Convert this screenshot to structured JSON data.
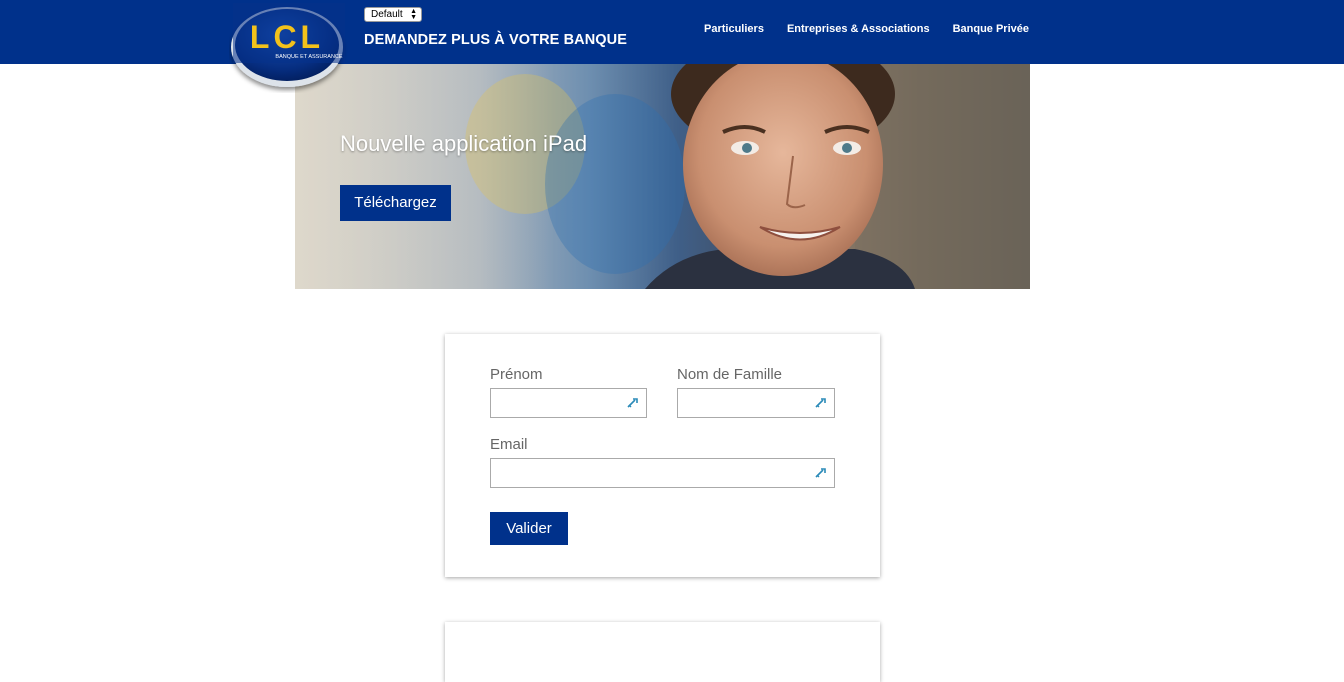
{
  "header": {
    "brand": {
      "logo_text": "LCL",
      "logo_subtext": "BANQUE ET ASSURANCE"
    },
    "variant_select": {
      "value": "Default"
    },
    "tagline": "DEMANDEZ PLUS À VOTRE BANQUE",
    "nav": [
      {
        "label": "Particuliers"
      },
      {
        "label": "Entreprises & Associations"
      },
      {
        "label": "Banque Privée"
      }
    ],
    "colors": {
      "bar": "#00318b",
      "logo_yellow": "#f3c21b"
    }
  },
  "hero": {
    "title": "Nouvelle application iPad",
    "button_label": "Téléchargez"
  },
  "form": {
    "first_name": {
      "label": "Prénom",
      "value": "",
      "icon": "key-autofill-icon"
    },
    "last_name": {
      "label": "Nom de Famille",
      "value": "",
      "icon": "key-autofill-icon"
    },
    "email": {
      "label": "Email",
      "value": "",
      "icon": "key-autofill-icon"
    },
    "submit_label": "Valider"
  }
}
